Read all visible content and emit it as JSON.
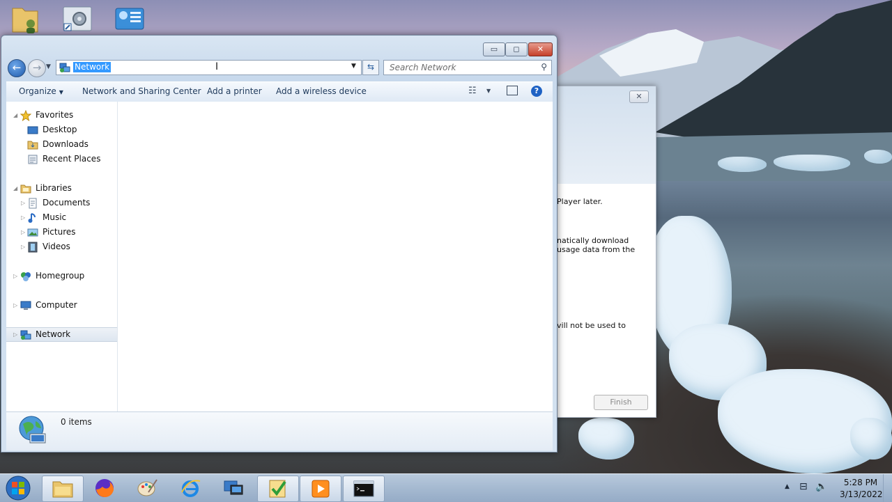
{
  "window": {
    "address": "Network",
    "search_placeholder": "Search Network",
    "min_glyph": "▭",
    "max_glyph": "◻",
    "close_glyph": "✕"
  },
  "toolbar": {
    "organize": "Organize",
    "network_sharing": "Network and Sharing Center",
    "add_printer": "Add a printer",
    "add_wireless": "Add a wireless device",
    "help": "?"
  },
  "nav": {
    "favorites": "Favorites",
    "desktop": "Desktop",
    "downloads": "Downloads",
    "recent_places": "Recent Places",
    "libraries": "Libraries",
    "documents": "Documents",
    "music": "Music",
    "pictures": "Pictures",
    "videos": "Videos",
    "homegroup": "Homegroup",
    "computer": "Computer",
    "network": "Network"
  },
  "details": {
    "item_count": "0 items"
  },
  "wizard": {
    "line1": "Player later.",
    "line2": "natically download",
    "line3": "usage data from the",
    "line4": "vill not be used to",
    "finish": "Finish",
    "close_glyph": "✕"
  },
  "tray": {
    "time": "5:28 PM",
    "date": "3/13/2022"
  },
  "colors": {
    "selection": "#3399ff",
    "window_frame": "#c8d9ec",
    "taskbar": "#a7bbd2"
  }
}
